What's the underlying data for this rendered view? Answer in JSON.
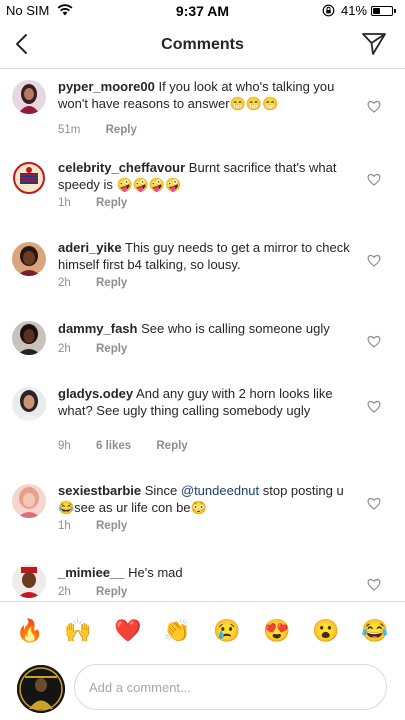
{
  "status_bar": {
    "carrier": "No SIM",
    "time": "9:37 AM",
    "battery_percent": "41%",
    "battery_level": 0.41
  },
  "header": {
    "title": "Comments"
  },
  "comments": [
    {
      "username": "pyper_moore00",
      "text": "If you look at who's talking you won't have reasons to answer😁😁😁",
      "time": "51m",
      "likes": "",
      "reply_label": "Reply"
    },
    {
      "username": "celebrity_cheffavour",
      "text": "Burnt sacrifice that's what speedy is 🤪🤪🤪🤪",
      "time": "1h",
      "likes": "",
      "reply_label": "Reply"
    },
    {
      "username": "aderi_yike",
      "text": "This guy needs to get a mirror to check himself first b4 talking, so lousy.",
      "time": "2h",
      "likes": "",
      "reply_label": "Reply"
    },
    {
      "username": "dammy_fash",
      "text": "See who is calling someone ugly",
      "time": "2h",
      "likes": "",
      "reply_label": "Reply"
    },
    {
      "username": "gladys.odey",
      "text": "And any guy with 2 horn looks like what? See ugly thing calling somebody ugly",
      "time": "9h",
      "likes": "6 likes",
      "reply_label": "Reply"
    },
    {
      "username": "sexiestbarbie",
      "text_before": "Since ",
      "mention": "@tundeednut",
      "text_after": " stop posting u😂see as ur life con be😳",
      "time": "1h",
      "likes": "",
      "reply_label": "Reply"
    },
    {
      "username": "_mimiee__",
      "text": "He's mad",
      "time": "2h",
      "likes": "",
      "reply_label": "Reply"
    }
  ],
  "emoji_bar": [
    "🔥",
    "🙌",
    "❤️",
    "👏",
    "😢",
    "😍",
    "😮",
    "😂"
  ],
  "composer": {
    "placeholder": "Add a comment..."
  },
  "icons": {
    "back": "chevron-left-icon",
    "send": "paper-plane-icon",
    "like": "heart-outline-icon"
  },
  "colors": {
    "text": "#262626",
    "secondary": "#8e8e8e",
    "mention": "#1b3f7a",
    "divider": "#dbdbdb"
  }
}
